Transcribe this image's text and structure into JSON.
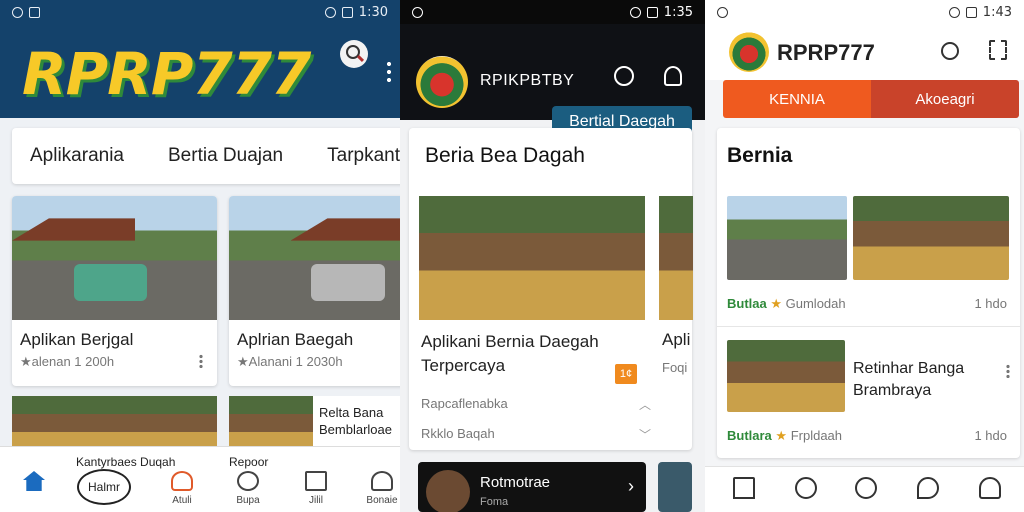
{
  "p1": {
    "status": {
      "time": "1:30"
    },
    "brand": "RPRP777",
    "tabs": [
      "Aplikarania",
      "Bertia Duajan",
      "Tarpkantu"
    ],
    "cards": [
      {
        "title": "Aplikan Berjgal",
        "meta": "★alenan 1 200h"
      },
      {
        "title": "Aplrian Baegah",
        "meta": "★Alanani 1 2030h"
      }
    ],
    "lower_card_text": "Relta Bana Bemblarloae",
    "nav": [
      {
        "label": "Kantyrbaes Duqah",
        "icon": "home-icon"
      },
      {
        "label": "Halmr",
        "icon": "badge-icon"
      },
      {
        "label": "Atuli",
        "icon": "cloud-icon"
      },
      {
        "label": "Bupa",
        "icon": "chat-icon"
      },
      {
        "label": "Jilil",
        "icon": "list-icon"
      },
      {
        "label": "Bonaie",
        "icon": "user-icon"
      }
    ],
    "nav_top_label": "Repoor"
  },
  "p2": {
    "status": {
      "time": "1:35"
    },
    "title": "RPIKPBTBY",
    "pill": "Bertial Daegah",
    "section": "Beria Bea Dagah",
    "item_title": "Aplikani Bernia Daegah Terpercaya",
    "badge": "1¢",
    "rows": [
      "Rapcaflenabka",
      "Rkklo Baqah"
    ],
    "peek_title": "Apli",
    "peek_meta": "Foqi",
    "dark_title": "Rotmotrae",
    "dark_sub": "Foma"
  },
  "p3": {
    "status": {
      "time": "1:43"
    },
    "title": "RPRP777",
    "seg": [
      "KENNIA",
      "Akoeagri"
    ],
    "section": "Bernia",
    "meta1": {
      "tag": "Butlaa",
      "name": "Gumlodah",
      "right": "1 hdo"
    },
    "item2_title": "Retinhar Banga Brambraya",
    "meta2": {
      "tag": "Butlara",
      "name": "Frpldaah",
      "right": "1 hdo"
    }
  },
  "colors": {
    "p1_bar": "#14426b",
    "brand_yellow": "#f7c928",
    "brand_green": "#2f8a3a",
    "p3_orange": "#ef5a1f",
    "p2_pill": "#1b5d80"
  }
}
